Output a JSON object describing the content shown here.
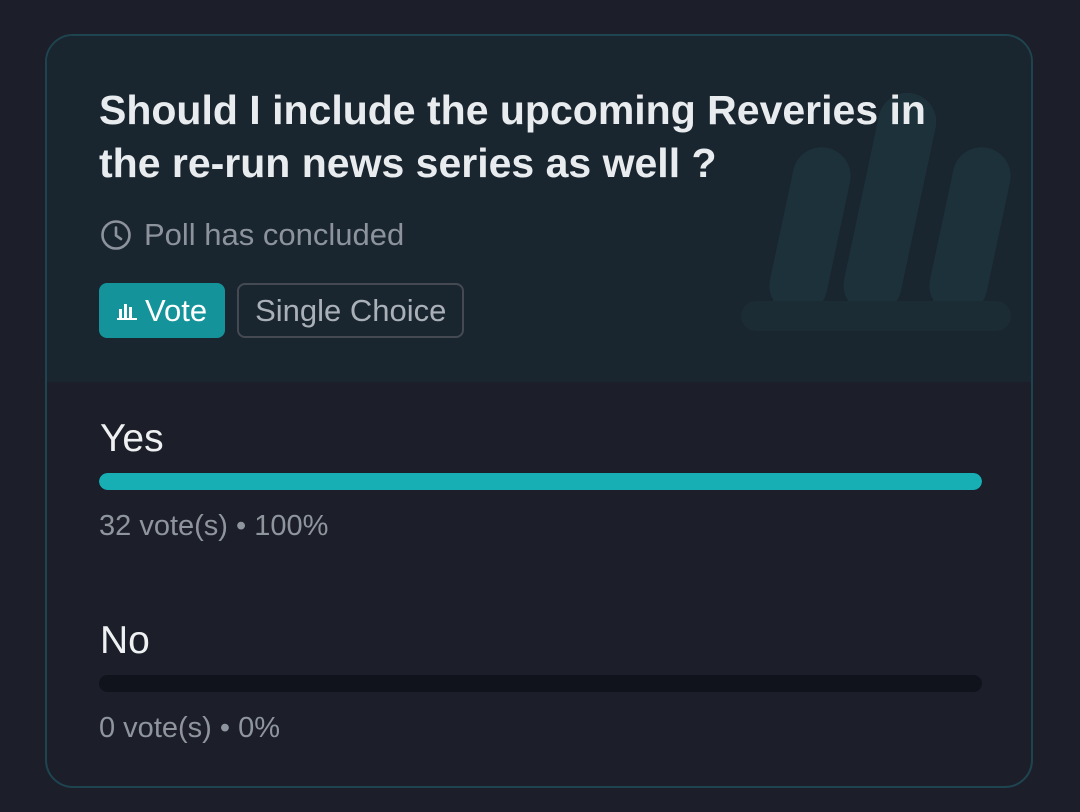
{
  "poll": {
    "question": "Should I include the upcoming Reveries in the re-run news series as well ?",
    "status": "Poll has concluded",
    "tag_vote": "Vote",
    "tag_type": "Single Choice",
    "options": [
      {
        "label": "Yes",
        "stats": "32 vote(s) • 100%",
        "fraction": 1.0
      },
      {
        "label": "No",
        "stats": "0 vote(s) • 0%",
        "fraction": 0.0
      }
    ]
  },
  "colors": {
    "accent": "#17aeb4",
    "vote_tag_bg": "#15939a",
    "header_bg": "#19252f",
    "page_bg": "#1c1e29"
  },
  "icons": {
    "status": "clock-icon",
    "vote_tag": "bar-chart-icon",
    "header_decoration": "poll-bars-watermark-icon"
  }
}
